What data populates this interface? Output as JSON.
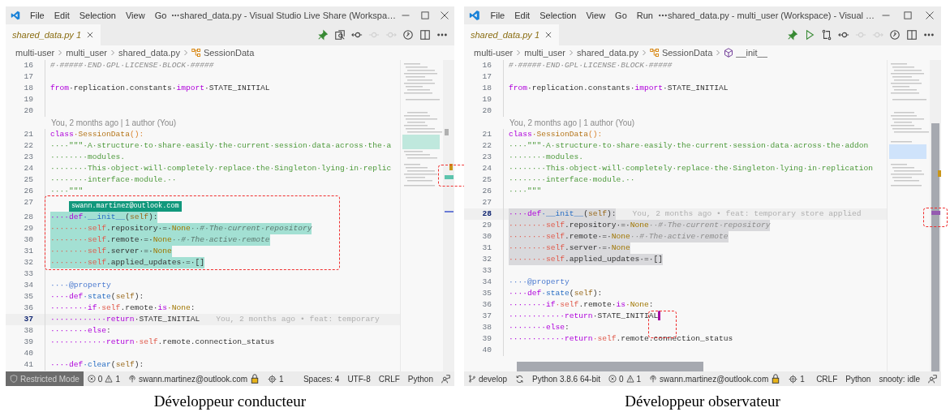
{
  "panels": [
    {
      "caption": "Développeur conducteur",
      "window": {
        "menus": [
          "File",
          "Edit",
          "Selection",
          "View",
          "Go"
        ],
        "title": "shared_data.py - Visual Studio Live Share (Workspa…",
        "tab": {
          "label": "shared_data.py",
          "badge": "1"
        },
        "toolbar": [
          {
            "kind": "pin",
            "disabled": false
          },
          {
            "kind": "search-compare",
            "disabled": false
          },
          {
            "kind": "commit",
            "disabled": false
          },
          {
            "kind": "prev",
            "disabled": true
          },
          {
            "kind": "next",
            "disabled": true
          },
          {
            "kind": "timeline",
            "disabled": false
          },
          {
            "kind": "split",
            "disabled": false
          },
          {
            "kind": "more",
            "disabled": false
          }
        ],
        "breadcrumb": [
          {
            "label": "multi-user",
            "kind": "folder"
          },
          {
            "label": "multi_user",
            "kind": "folder"
          },
          {
            "label": "shared_data.py",
            "kind": "file"
          },
          {
            "label": "SessionData",
            "kind": "class"
          }
        ],
        "lines": [
          {
            "kind": "code",
            "num": "16",
            "current": false,
            "cursor": false,
            "tokens": [
              {
                "text": "#·#####·END·GPL·LICENSE·BLOCK·#####",
                "kind": "cm"
              }
            ]
          },
          {
            "kind": "code",
            "num": "17",
            "current": false,
            "cursor": false
          },
          {
            "kind": "code",
            "num": "18",
            "current": false,
            "cursor": false,
            "tokens": [
              {
                "text": "from",
                "kind": "kw"
              },
              {
                "text": "·replication.constants·",
                "kind": "tx"
              },
              {
                "text": "import",
                "kind": "kw"
              },
              {
                "text": "·STATE_INITIAL",
                "kind": "tx"
              }
            ]
          },
          {
            "kind": "code",
            "num": "19",
            "current": false,
            "cursor": false
          },
          {
            "kind": "code",
            "num": "20",
            "current": false,
            "cursor": false
          },
          {
            "kind": "blame-header",
            "text": "You, 2 months ago | 1 author (You)"
          },
          {
            "kind": "code",
            "num": "21",
            "current": false,
            "cursor": false,
            "tokens": [
              {
                "text": "class",
                "kind": "kw"
              },
              {
                "text": "·SessionData",
                "kind": "cls"
              },
              {
                "text": "():",
                "kind": "par"
              }
            ]
          },
          {
            "kind": "code",
            "num": "22",
            "current": false,
            "cursor": false,
            "tokens": [
              {
                "text": "····\"\"\"·A·structure·to·share·easily·the·current·session·data·across·the·a",
                "kind": "str"
              }
            ]
          },
          {
            "kind": "code",
            "num": "23",
            "current": false,
            "cursor": false,
            "tokens": [
              {
                "text": "········modules.",
                "kind": "str"
              }
            ]
          },
          {
            "kind": "code",
            "num": "24",
            "current": false,
            "cursor": false,
            "tokens": [
              {
                "text": "········This·object·will·completely·replace·the·Singleton·lying·in·replic",
                "kind": "str"
              }
            ]
          },
          {
            "kind": "code",
            "num": "25",
            "current": false,
            "cursor": false,
            "tokens": [
              {
                "text": "········interface·module.··",
                "kind": "str"
              }
            ]
          },
          {
            "kind": "code",
            "num": "26",
            "current": false,
            "cursor": false,
            "tokens": [
              {
                "text": "····\"\"\"",
                "kind": "str"
              }
            ]
          },
          {
            "kind": "code",
            "num": "27",
            "current": false,
            "cursor": false,
            "tag": "swann.martinez@outlook.com"
          },
          {
            "kind": "code",
            "num": "28",
            "remote_selection": true,
            "current": false,
            "cursor": false,
            "tokens": [
              {
                "text": "····def",
                "kind": "kw"
              },
              {
                "text": "·__init__",
                "kind": "fn"
              },
              {
                "text": "(",
                "kind": "tx"
              },
              {
                "text": "self",
                "kind": "arg"
              },
              {
                "text": "):",
                "kind": "tx"
              }
            ]
          },
          {
            "kind": "code",
            "num": "29",
            "remote_selection": true,
            "current": false,
            "cursor": false,
            "tokens": [
              {
                "text": "········self",
                "kind": "self"
              },
              {
                "text": ".repository·=·",
                "kind": "tx"
              },
              {
                "text": "None",
                "kind": "none"
              },
              {
                "text": "··#·The·current·repository",
                "kind": "cm"
              }
            ]
          },
          {
            "kind": "code",
            "num": "30",
            "remote_selection": true,
            "current": false,
            "cursor": false,
            "tokens": [
              {
                "text": "········self",
                "kind": "self"
              },
              {
                "text": ".remote·=·",
                "kind": "tx"
              },
              {
                "text": "None",
                "kind": "none"
              },
              {
                "text": "··#·The·active·remote",
                "kind": "cm"
              }
            ]
          },
          {
            "kind": "code",
            "num": "31",
            "remote_selection": true,
            "current": false,
            "cursor": false,
            "tokens": [
              {
                "text": "········self",
                "kind": "self"
              },
              {
                "text": ".server·=·",
                "kind": "tx"
              },
              {
                "text": "None",
                "kind": "none"
              }
            ]
          },
          {
            "kind": "code",
            "num": "32",
            "remote_selection": true,
            "current": false,
            "cursor": false,
            "tokens": [
              {
                "text": "········self",
                "kind": "self"
              },
              {
                "text": ".applied_updates·=·[]",
                "kind": "tx"
              }
            ]
          },
          {
            "kind": "code",
            "num": "33",
            "current": false,
            "cursor": false
          },
          {
            "kind": "code",
            "num": "34",
            "current": false,
            "cursor": false,
            "tokens": [
              {
                "text": "····@property",
                "kind": "dec"
              }
            ]
          },
          {
            "kind": "code",
            "num": "35",
            "current": false,
            "cursor": false,
            "tokens": [
              {
                "text": "····def",
                "kind": "kw"
              },
              {
                "text": "·state",
                "kind": "fn"
              },
              {
                "text": "(",
                "kind": "tx"
              },
              {
                "text": "self",
                "kind": "arg"
              },
              {
                "text": "):",
                "kind": "tx"
              }
            ]
          },
          {
            "kind": "code",
            "num": "36",
            "current": false,
            "cursor": false,
            "tokens": [
              {
                "text": "········if",
                "kind": "kw"
              },
              {
                "text": "·self",
                "kind": "self"
              },
              {
                "text": ".remote·",
                "kind": "tx"
              },
              {
                "text": "is",
                "kind": "kw"
              },
              {
                "text": "·None",
                "kind": "none"
              },
              {
                "text": ":",
                "kind": "tx"
              }
            ]
          },
          {
            "kind": "code",
            "num": "37",
            "current": true,
            "cursor": false,
            "blame": "You, 2 months ago • feat: temporary",
            "tokens": [
              {
                "text": "············return",
                "kind": "kw"
              },
              {
                "text": "·STATE_INITIAL",
                "kind": "tx"
              }
            ]
          },
          {
            "kind": "code",
            "num": "38",
            "current": false,
            "cursor": false,
            "tokens": [
              {
                "text": "········else",
                "kind": "kw"
              },
              {
                "text": ":",
                "kind": "tx"
              }
            ]
          },
          {
            "kind": "code",
            "num": "39",
            "current": false,
            "cursor": false,
            "tokens": [
              {
                "text": "············return",
                "kind": "kw"
              },
              {
                "text": "·self",
                "kind": "self"
              },
              {
                "text": ".remote.connection_status",
                "kind": "tx"
              }
            ]
          },
          {
            "kind": "code",
            "num": "40",
            "current": false,
            "cursor": false
          },
          {
            "kind": "code",
            "num": "41",
            "current": false,
            "cursor": false,
            "tokens": [
              {
                "text": "····def",
                "kind": "kw"
              },
              {
                "text": "·clear",
                "kind": "fn"
              },
              {
                "text": "(",
                "kind": "tx"
              },
              {
                "text": "self",
                "kind": "arg"
              },
              {
                "text": "):",
                "kind": "tx"
              }
            ]
          }
        ],
        "status": {
          "left": [
            {
              "kind": "restricted",
              "label": "Restricted Mode"
            },
            {
              "kind": "problems",
              "errors": "0",
              "warnings": "1"
            },
            {
              "kind": "liveshare",
              "label": "swann.martinez@outlook.com"
            },
            {
              "kind": "ports",
              "label": "1"
            }
          ],
          "right": [
            {
              "kind": "text",
              "label": "Spaces: 4"
            },
            {
              "kind": "text",
              "label": "UTF-8"
            },
            {
              "kind": "text",
              "label": "CRLF"
            },
            {
              "kind": "text",
              "label": "Python"
            },
            {
              "kind": "feedback"
            }
          ]
        }
      }
    },
    {
      "caption": "Développeur observateur",
      "window": {
        "menus": [
          "File",
          "Edit",
          "Selection",
          "View",
          "Go",
          "Run"
        ],
        "title": "shared_data.py - multi_user (Workspace) - Visual …",
        "tab": {
          "label": "shared_data.py",
          "badge": "1"
        },
        "toolbar": [
          {
            "kind": "pin",
            "disabled": false
          },
          {
            "kind": "play",
            "disabled": false
          },
          {
            "kind": "compare",
            "disabled": false
          },
          {
            "kind": "commit",
            "disabled": false
          },
          {
            "kind": "prev",
            "disabled": true
          },
          {
            "kind": "next",
            "disabled": true
          },
          {
            "kind": "timeline",
            "disabled": false
          },
          {
            "kind": "split",
            "disabled": false
          },
          {
            "kind": "more",
            "disabled": false
          }
        ],
        "breadcrumb": [
          {
            "label": "multi-user",
            "kind": "folder"
          },
          {
            "label": "multi_user",
            "kind": "folder"
          },
          {
            "label": "shared_data.py",
            "kind": "file"
          },
          {
            "label": "SessionData",
            "kind": "class"
          },
          {
            "label": "__init__",
            "kind": "method"
          }
        ],
        "lines": [
          {
            "kind": "code",
            "num": "16",
            "current": false,
            "cursor": false,
            "tokens": [
              {
                "text": "#·#####·END·GPL·LICENSE·BLOCK·#####",
                "kind": "cm"
              }
            ]
          },
          {
            "kind": "code",
            "num": "17",
            "current": false,
            "cursor": false
          },
          {
            "kind": "code",
            "num": "18",
            "current": false,
            "cursor": false,
            "tokens": [
              {
                "text": "from",
                "kind": "kw"
              },
              {
                "text": "·replication.constants·",
                "kind": "tx"
              },
              {
                "text": "import",
                "kind": "kw"
              },
              {
                "text": "·STATE_INITIAL",
                "kind": "tx"
              }
            ]
          },
          {
            "kind": "code",
            "num": "19",
            "current": false,
            "cursor": false
          },
          {
            "kind": "code",
            "num": "20",
            "current": false,
            "cursor": false
          },
          {
            "kind": "blame-header",
            "text": "You, 2 months ago | 1 author (You)"
          },
          {
            "kind": "code",
            "num": "21",
            "current": false,
            "cursor": false,
            "tokens": [
              {
                "text": "class",
                "kind": "kw"
              },
              {
                "text": "·SessionData",
                "kind": "cls"
              },
              {
                "text": "():",
                "kind": "par"
              }
            ]
          },
          {
            "kind": "code",
            "num": "22",
            "current": false,
            "cursor": false,
            "tokens": [
              {
                "text": "····\"\"\"·A·structure·to·share·easily·the·current·session·data·across·the·addon",
                "kind": "str"
              }
            ]
          },
          {
            "kind": "code",
            "num": "23",
            "current": false,
            "cursor": false,
            "tokens": [
              {
                "text": "········modules.",
                "kind": "str"
              }
            ]
          },
          {
            "kind": "code",
            "num": "24",
            "current": false,
            "cursor": false,
            "tokens": [
              {
                "text": "········This·object·will·completely·replace·the·Singleton·lying·in·replication",
                "kind": "str"
              }
            ]
          },
          {
            "kind": "code",
            "num": "25",
            "current": false,
            "cursor": false,
            "tokens": [
              {
                "text": "········interface·module.··",
                "kind": "str"
              }
            ]
          },
          {
            "kind": "code",
            "num": "26",
            "current": false,
            "cursor": false,
            "tokens": [
              {
                "text": "····\"\"\"",
                "kind": "str"
              }
            ]
          },
          {
            "kind": "code",
            "num": "27",
            "current": false,
            "cursor": false
          },
          {
            "kind": "code",
            "num": "28",
            "selected": true,
            "current": true,
            "cursor": false,
            "blame": "You, 2 months ago • feat: temporary store applied",
            "tokens": [
              {
                "text": "····def",
                "kind": "kw"
              },
              {
                "text": "·__init__",
                "kind": "fn"
              },
              {
                "text": "(",
                "kind": "tx"
              },
              {
                "text": "self",
                "kind": "arg"
              },
              {
                "text": "):",
                "kind": "tx"
              }
            ]
          },
          {
            "kind": "code",
            "num": "29",
            "selected": true,
            "current": false,
            "cursor": false,
            "tokens": [
              {
                "text": "········self",
                "kind": "self"
              },
              {
                "text": ".repository·=·",
                "kind": "tx"
              },
              {
                "text": "None",
                "kind": "none"
              },
              {
                "text": "··#·The·current·repository",
                "kind": "cm"
              }
            ]
          },
          {
            "kind": "code",
            "num": "30",
            "selected": true,
            "current": false,
            "cursor": false,
            "tokens": [
              {
                "text": "········self",
                "kind": "self"
              },
              {
                "text": ".remote·=·",
                "kind": "tx"
              },
              {
                "text": "None",
                "kind": "none"
              },
              {
                "text": "··#·The·active·remote",
                "kind": "cm"
              }
            ]
          },
          {
            "kind": "code",
            "num": "31",
            "selected": true,
            "current": false,
            "cursor": false,
            "tokens": [
              {
                "text": "········self",
                "kind": "self"
              },
              {
                "text": ".server·=·",
                "kind": "tx"
              },
              {
                "text": "None",
                "kind": "none"
              }
            ]
          },
          {
            "kind": "code",
            "num": "32",
            "selected": true,
            "current": false,
            "cursor": false,
            "tokens": [
              {
                "text": "········self",
                "kind": "self"
              },
              {
                "text": ".applied_updates·=·[]",
                "kind": "tx"
              }
            ]
          },
          {
            "kind": "code",
            "num": "33",
            "current": false,
            "cursor": false
          },
          {
            "kind": "code",
            "num": "34",
            "current": false,
            "cursor": false,
            "tokens": [
              {
                "text": "····@property",
                "kind": "dec"
              }
            ]
          },
          {
            "kind": "code",
            "num": "35",
            "current": false,
            "cursor": false,
            "tokens": [
              {
                "text": "····def",
                "kind": "kw"
              },
              {
                "text": "·state",
                "kind": "fn"
              },
              {
                "text": "(",
                "kind": "tx"
              },
              {
                "text": "self",
                "kind": "arg"
              },
              {
                "text": "):",
                "kind": "tx"
              }
            ]
          },
          {
            "kind": "code",
            "num": "36",
            "current": false,
            "cursor": false,
            "tokens": [
              {
                "text": "········if",
                "kind": "kw"
              },
              {
                "text": "·self",
                "kind": "self"
              },
              {
                "text": ".remote·",
                "kind": "tx"
              },
              {
                "text": "is",
                "kind": "kw"
              },
              {
                "text": "·None",
                "kind": "none"
              },
              {
                "text": ":",
                "kind": "tx"
              }
            ]
          },
          {
            "kind": "code",
            "num": "37",
            "current": false,
            "cursor": true,
            "tokens": [
              {
                "text": "············return",
                "kind": "kw"
              },
              {
                "text": "·STATE_INITIAL",
                "kind": "tx"
              }
            ]
          },
          {
            "kind": "code",
            "num": "38",
            "current": false,
            "cursor": false,
            "tokens": [
              {
                "text": "········else",
                "kind": "kw"
              },
              {
                "text": ":",
                "kind": "tx"
              }
            ]
          },
          {
            "kind": "code",
            "num": "39",
            "current": false,
            "cursor": false,
            "tokens": [
              {
                "text": "············return",
                "kind": "kw"
              },
              {
                "text": "·self",
                "kind": "self"
              },
              {
                "text": ".remote.connection_status",
                "kind": "tx"
              }
            ]
          },
          {
            "kind": "code",
            "num": "40",
            "current": false,
            "cursor": false
          }
        ],
        "status": {
          "left": [
            {
              "kind": "branch",
              "label": "develop"
            },
            {
              "kind": "sync"
            },
            {
              "kind": "text",
              "label": "Python 3.8.6 64-bit"
            },
            {
              "kind": "problems",
              "errors": "0",
              "warnings": "1"
            },
            {
              "kind": "liveshare",
              "label": "swann.martinez@outlook.com"
            },
            {
              "kind": "ports",
              "label": "1"
            }
          ],
          "right": [
            {
              "kind": "text",
              "label": "CRLF"
            },
            {
              "kind": "text",
              "label": "Python"
            },
            {
              "kind": "text",
              "label": "snooty: idle"
            },
            {
              "kind": "feedback"
            }
          ]
        }
      }
    }
  ]
}
